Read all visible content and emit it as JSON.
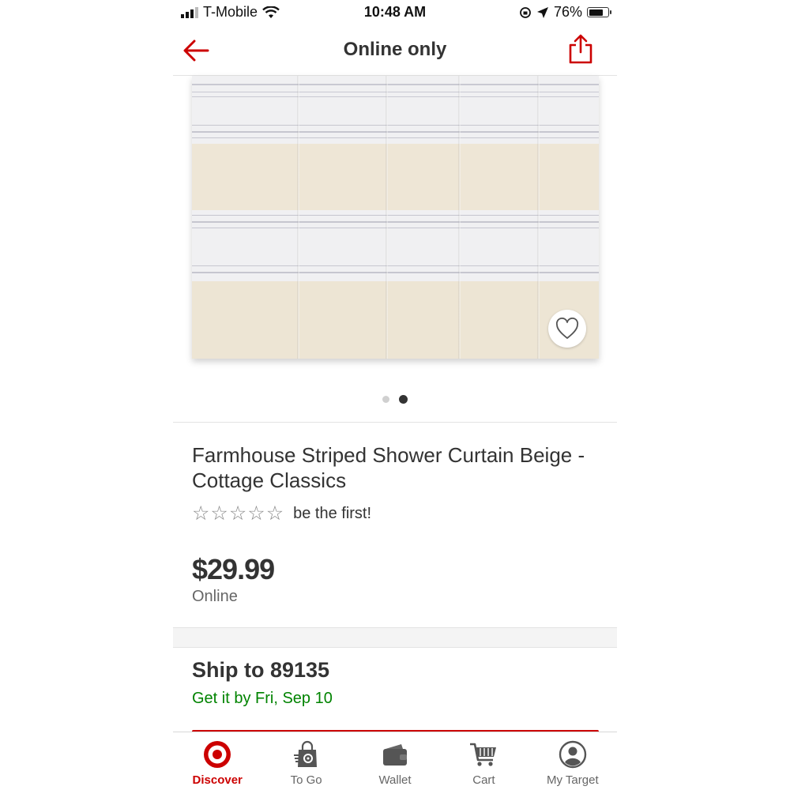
{
  "status_bar": {
    "carrier": "T-Mobile",
    "time": "10:48 AM",
    "battery": "76%",
    "battery_level": 0.76
  },
  "nav": {
    "title": "Online only",
    "back_icon": "back-arrow-icon",
    "share_icon": "share-icon"
  },
  "gallery": {
    "image_count": 2,
    "active_index": 1,
    "favorite_icon": "heart-icon"
  },
  "product": {
    "title": "Farmhouse Striped Shower Curtain Beige - Cottage Classics",
    "rating_stars": 0,
    "rating_text": "be the first!",
    "price": "$29.99",
    "price_note": "Online"
  },
  "shipping": {
    "title": "Ship to 89135",
    "delivery": "Get it by Fri, Sep 10"
  },
  "tabbar": {
    "items": [
      {
        "label": "Discover",
        "icon": "target-logo-icon",
        "active": true
      },
      {
        "label": "To Go",
        "icon": "shopping-bag-icon",
        "active": false
      },
      {
        "label": "Wallet",
        "icon": "wallet-icon",
        "active": false
      },
      {
        "label": "Cart",
        "icon": "cart-icon",
        "active": false
      },
      {
        "label": "My Target",
        "icon": "user-icon",
        "active": false
      }
    ]
  },
  "colors": {
    "accent": "#cc0000",
    "text": "#333333",
    "delivery_green": "#008300"
  }
}
